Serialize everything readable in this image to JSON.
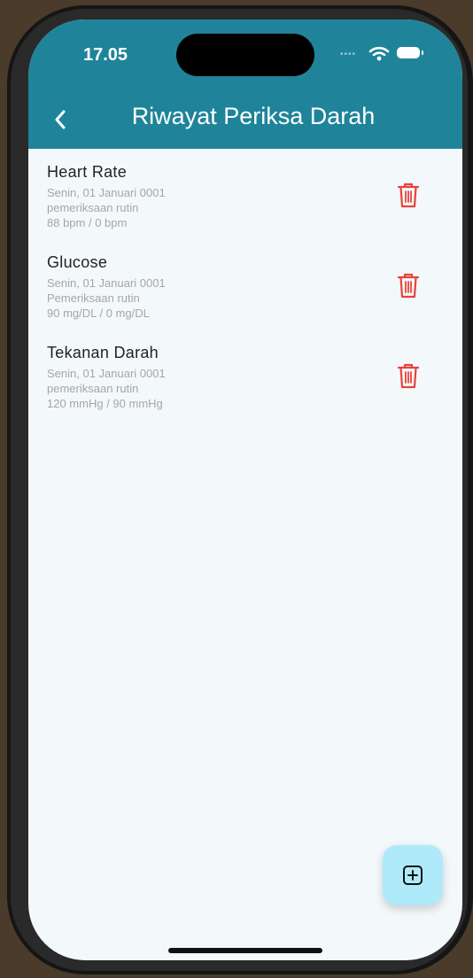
{
  "status_bar": {
    "time": "17.05"
  },
  "header": {
    "title": "Riwayat Periksa Darah"
  },
  "records": [
    {
      "title": "Heart Rate",
      "date": "Senin, 01 Januari 0001",
      "note": "pemeriksaan rutin",
      "value": "88 bpm / 0 bpm"
    },
    {
      "title": "Glucose",
      "date": "Senin, 01 Januari 0001",
      "note": "Pemeriksaan rutin",
      "value": "90 mg/DL / 0 mg/DL"
    },
    {
      "title": "Tekanan Darah",
      "date": "Senin, 01 Januari 0001",
      "note": "pemeriksaan rutin",
      "value": "120 mmHg / 90 mmHg"
    }
  ],
  "icons": {
    "back": "chevron-left-icon",
    "delete": "trash-icon",
    "add": "plus-square-icon"
  },
  "colors": {
    "header": "#1f8499",
    "delete": "#e8433a",
    "fab": "#aeeafa"
  }
}
